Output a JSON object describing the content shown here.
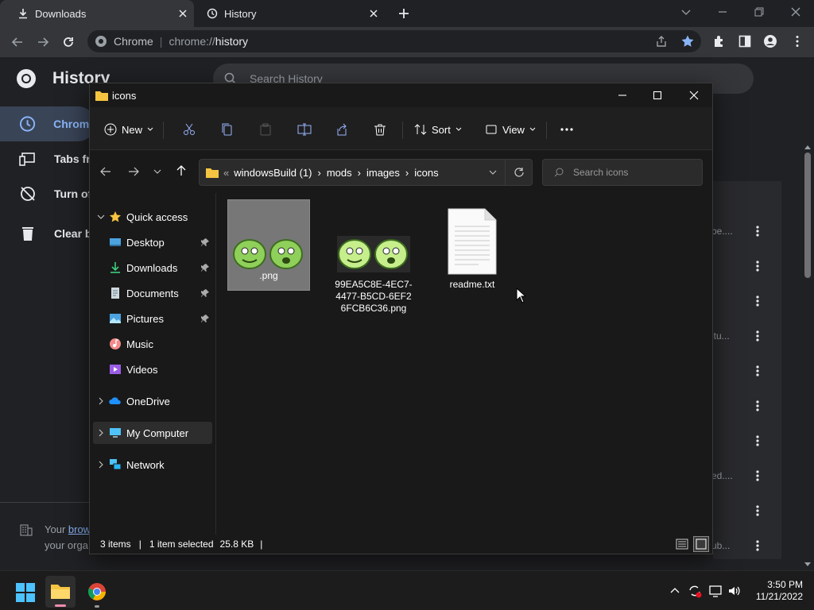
{
  "browser": {
    "tabs": [
      {
        "title": "Downloads"
      },
      {
        "title": "History"
      }
    ],
    "omnibox": {
      "site_label": "Chrome",
      "url_prefix": "chrome://",
      "url_path": "history"
    }
  },
  "history_page": {
    "title": "History",
    "search_placeholder": "Search History",
    "sidebar": [
      {
        "label": "Chrome"
      },
      {
        "label": "Tabs fr"
      },
      {
        "label": "Turn of"
      },
      {
        "label": "Clear b"
      }
    ],
    "snippets": [
      "be....",
      "itu...",
      "ed....",
      "ub..."
    ],
    "managed": {
      "prefix": "Your ",
      "link": "brow",
      "line2": "your orga"
    }
  },
  "explorer": {
    "title": "icons",
    "commands": {
      "new": "New",
      "sort": "Sort",
      "view": "View"
    },
    "breadcrumb": [
      "windowsBuild (1)",
      "mods",
      "images",
      "icons"
    ],
    "search_placeholder": "Search icons",
    "nav": [
      {
        "label": "Quick access",
        "icon": "star-icon"
      },
      {
        "label": "Desktop",
        "icon": "desktop-folder-icon",
        "pinned": true
      },
      {
        "label": "Downloads",
        "icon": "downloads-folder-icon",
        "pinned": true
      },
      {
        "label": "Documents",
        "icon": "documents-folder-icon",
        "pinned": true
      },
      {
        "label": "Pictures",
        "icon": "pictures-folder-icon",
        "pinned": true
      },
      {
        "label": "Music",
        "icon": "music-folder-icon"
      },
      {
        "label": "Videos",
        "icon": "videos-folder-icon"
      },
      {
        "label": "OneDrive",
        "icon": "onedrive-icon"
      },
      {
        "label": "My Computer",
        "icon": "computer-icon"
      },
      {
        "label": "Network",
        "icon": "network-icon"
      }
    ],
    "files": [
      {
        "name": ".png",
        "selected": true
      },
      {
        "name": "99EA5C8E-4EC7-4477-B5CD-6EF26FCB6C36.png",
        "name_lines": [
          "99EA5C8E-4EC7-",
          "4477-B5CD-6EF2",
          "6FCB6C36.png"
        ]
      },
      {
        "name": "readme.txt"
      }
    ],
    "status": {
      "items": "3 items",
      "selected": "1 item selected",
      "size": "25.8 KB"
    }
  },
  "taskbar": {
    "time": "3:50 PM",
    "date": "11/21/2022"
  },
  "colors": {
    "accent_blue": "#8ab4f8",
    "selection": "#777777",
    "sidebar_active": "#394457",
    "folder_yellow": "#f5c542"
  }
}
